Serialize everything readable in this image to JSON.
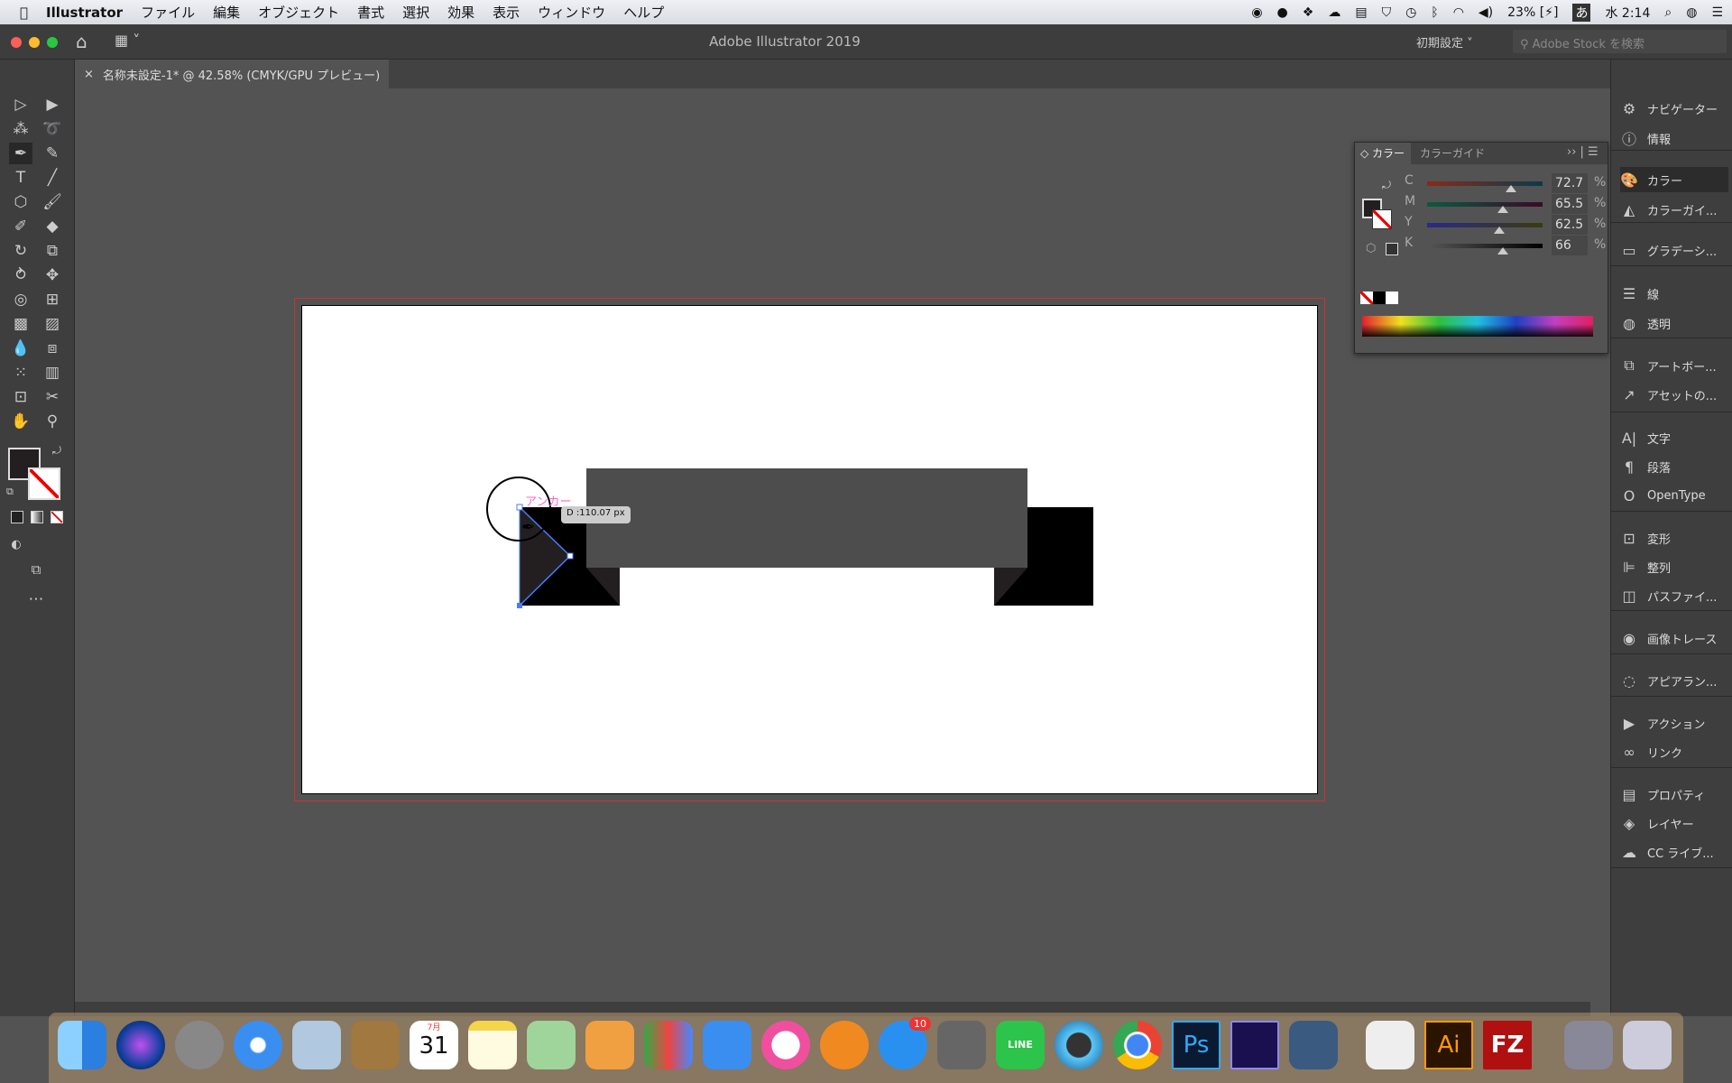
{
  "menubar": {
    "apple": "",
    "app": "Illustrator",
    "items": [
      "ファイル",
      "編集",
      "オブジェクト",
      "書式",
      "選択",
      "効果",
      "表示",
      "ウィンドウ",
      "ヘルプ"
    ],
    "status": {
      "battery": "23%",
      "ime": "あ",
      "clock": "水 2:14"
    }
  },
  "titlebar": {
    "title": "Adobe Illustrator 2019",
    "workspace": "初期設定",
    "search_placeholder": "Adobe Stock を検索"
  },
  "document_tab": {
    "close": "×",
    "label": "名称未設定-1* @ 42.58% (CMYK/GPU プレビュー)"
  },
  "canvas": {
    "anchor_label": "アンカー",
    "distance_tooltip": "D :110.07 px"
  },
  "color_panel": {
    "tabs": [
      "カラー",
      "カラーガイド"
    ],
    "channels": [
      {
        "label": "C",
        "value": "72.7",
        "fraction": 0.727
      },
      {
        "label": "M",
        "value": "65.5",
        "fraction": 0.655
      },
      {
        "label": "Y",
        "value": "62.5",
        "fraction": 0.625
      },
      {
        "label": "K",
        "value": "66",
        "fraction": 0.66
      }
    ],
    "unit": "%"
  },
  "right_panels": [
    {
      "icon": "compass-icon",
      "label": "ナビゲーター"
    },
    {
      "icon": "info-icon",
      "label": "情報"
    },
    {
      "icon": "palette-icon",
      "label": "カラー",
      "active": true
    },
    {
      "icon": "color-guide-icon",
      "label": "カラーガイ..."
    },
    {
      "icon": "gradient-icon",
      "label": "グラデーシ..."
    },
    {
      "icon": "stroke-icon",
      "label": "線"
    },
    {
      "icon": "transparency-icon",
      "label": "透明"
    },
    {
      "icon": "artboard-icon",
      "label": "アートボー..."
    },
    {
      "icon": "export-icon",
      "label": "アセットの..."
    },
    {
      "icon": "character-icon",
      "label": "文字"
    },
    {
      "icon": "paragraph-icon",
      "label": "段落"
    },
    {
      "icon": "opentype-icon",
      "label": "OpenType"
    },
    {
      "icon": "transform-icon",
      "label": "変形"
    },
    {
      "icon": "align-icon",
      "label": "整列"
    },
    {
      "icon": "pathfinder-icon",
      "label": "パスファイ..."
    },
    {
      "icon": "image-trace-icon",
      "label": "画像トレース"
    },
    {
      "icon": "appearance-icon",
      "label": "アピアラン..."
    },
    {
      "icon": "play-icon",
      "label": "アクション"
    },
    {
      "icon": "link-icon",
      "label": "リンク"
    },
    {
      "icon": "properties-icon",
      "label": "プロパティ"
    },
    {
      "icon": "layers-icon",
      "label": "レイヤー"
    },
    {
      "icon": "cc-libraries-icon",
      "label": "CC ライブ..."
    }
  ],
  "dock": {
    "badge": "10",
    "calendar_month": "7月",
    "calendar_day": "31",
    "ps": "Ps",
    "ai": "Ai",
    "fz": "FZ",
    "line": "LINE"
  },
  "colors": {
    "fill": "#231f20",
    "shape_gray": "#4d4d4d",
    "selection": "#4a7bff",
    "anchor_label": "#ff66cc"
  }
}
